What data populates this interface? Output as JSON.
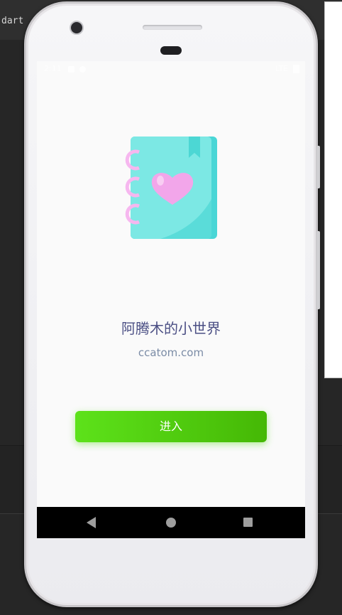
{
  "ide": {
    "tab_label": "dart"
  },
  "status_bar": {
    "time": "2:11",
    "signal": "LTE"
  },
  "app": {
    "title": "阿腾木的小世界",
    "domain": "ccatom.com",
    "enter_button_label": "进入",
    "illustration_icon": "notebook-heart-icon"
  },
  "navigation": {
    "back_icon": "back-triangle-icon",
    "home_icon": "home-circle-icon",
    "recent_icon": "recent-apps-square-icon"
  },
  "colors": {
    "title": "#4b4f84",
    "domain": "#7b8ca6",
    "button_start": "#5de21a",
    "button_end": "#45b805",
    "notebook_cover": "#7ce8e4",
    "heart": "#f2a6ea"
  }
}
